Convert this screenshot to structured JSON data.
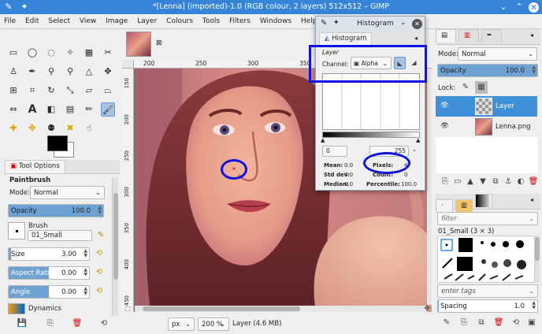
{
  "window": {
    "title": "*[Lenna] (imported)-1.0 (RGB colour, 2 layers) 512x512 – GIMP"
  },
  "menu": [
    "File",
    "Edit",
    "Select",
    "View",
    "Image",
    "Layer",
    "Colours",
    "Tools",
    "Filters",
    "Windows",
    "Help"
  ],
  "image_tab": {
    "close": "⊠"
  },
  "ruler": {
    "h_ticks": [
      "200",
      "250",
      "300",
      "350"
    ],
    "v_ticks": [
      "150",
      "200",
      "250",
      "300",
      "350",
      "400",
      "450"
    ]
  },
  "tool_options": {
    "tab_label": "Tool Options",
    "tool_name": "Paintbrush",
    "mode_label": "Mode:",
    "mode_value": "Normal",
    "opacity": {
      "label": "Opacity",
      "value": "100.0",
      "fraction": 1.0
    },
    "brush": {
      "label": "Brush",
      "value": "01_Small"
    },
    "size": {
      "label": "Size",
      "value": "3.00",
      "fraction": 0.03
    },
    "aspect": {
      "label": "Aspect Ratio",
      "value": "0.00",
      "fraction": 0.5
    },
    "angle": {
      "label": "Angle",
      "value": "0.00",
      "fraction": 0.5
    },
    "dynamics": {
      "label": "Dynamics"
    }
  },
  "histogram": {
    "window_title": "Histogram",
    "tab_label": "Histogram",
    "section": "Layer",
    "channel_label": "Channel:",
    "channel_value": "Alpha",
    "range_min": "0",
    "range_max": "255",
    "stats": {
      "mean": {
        "label": "Mean:",
        "value": "0.0"
      },
      "stddev": {
        "label": "Std dev:",
        "value": "0.0"
      },
      "median": {
        "label": "Median:",
        "value": "0.0"
      },
      "pixels": {
        "label": "Pixels:",
        "value": "4"
      },
      "count": {
        "label": "Count:",
        "value": "0"
      },
      "percentile": {
        "label": "Percentile:",
        "value": "100.0"
      }
    }
  },
  "layers": {
    "mode_label": "Mode:",
    "mode_value": "Normal",
    "opacity": {
      "label": "Opacity",
      "value": "100.0",
      "fraction": 1.0
    },
    "lock_label": "Lock:",
    "items": [
      {
        "name": "Layer",
        "visible": true,
        "selected": true
      },
      {
        "name": "Lenna.png",
        "visible": true,
        "selected": false
      }
    ]
  },
  "brushes": {
    "filter_placeholder": "filter",
    "current": "01_Small (3 × 3)",
    "tags_placeholder": "enter tags",
    "spacing": {
      "label": "Spacing",
      "value": "1.0",
      "fraction": 0.01
    }
  },
  "statusbar": {
    "unit": "px",
    "zoom": "200 %",
    "info": "Layer (4.6 MB)"
  },
  "colors": {
    "accent": "#3584d8",
    "annotation": "#1010e0",
    "fg": "#000000",
    "bg": "#ffffff"
  }
}
